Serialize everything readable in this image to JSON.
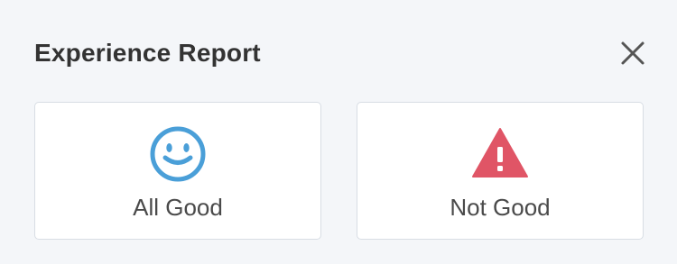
{
  "dialog": {
    "title": "Experience Report",
    "close_icon": "close-icon"
  },
  "options": [
    {
      "label": "All Good",
      "icon": "smiley-face-icon",
      "icon_color": "#4a9fd8"
    },
    {
      "label": "Not Good",
      "icon": "warning-triangle-icon",
      "icon_color": "#e05566"
    }
  ],
  "colors": {
    "background": "#f4f6f9",
    "card_background": "#ffffff",
    "card_border": "#d8dde4",
    "title_text": "#333333",
    "label_text": "#4a4a4a"
  }
}
